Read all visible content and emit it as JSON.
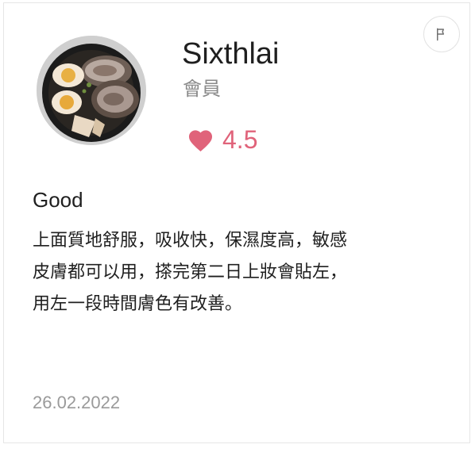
{
  "review": {
    "user_name": "Sixthlai",
    "user_role": "會員",
    "rating": "4.5",
    "title": "Good",
    "body_lines": [
      "上面質地舒服，吸收快，保濕度高，敏感",
      "皮膚都可以用，搽完第二日上妝會貼左，",
      "用左一段時間膚色有改善。"
    ],
    "date": "26.02.2022"
  },
  "colors": {
    "rating_accent": "#e0637a",
    "muted_text": "#8a8a8a",
    "border": "#e6e6e6"
  },
  "icons": {
    "rating": "heart-icon",
    "report": "flag-icon",
    "avatar": "ramen-bowl-photo"
  }
}
